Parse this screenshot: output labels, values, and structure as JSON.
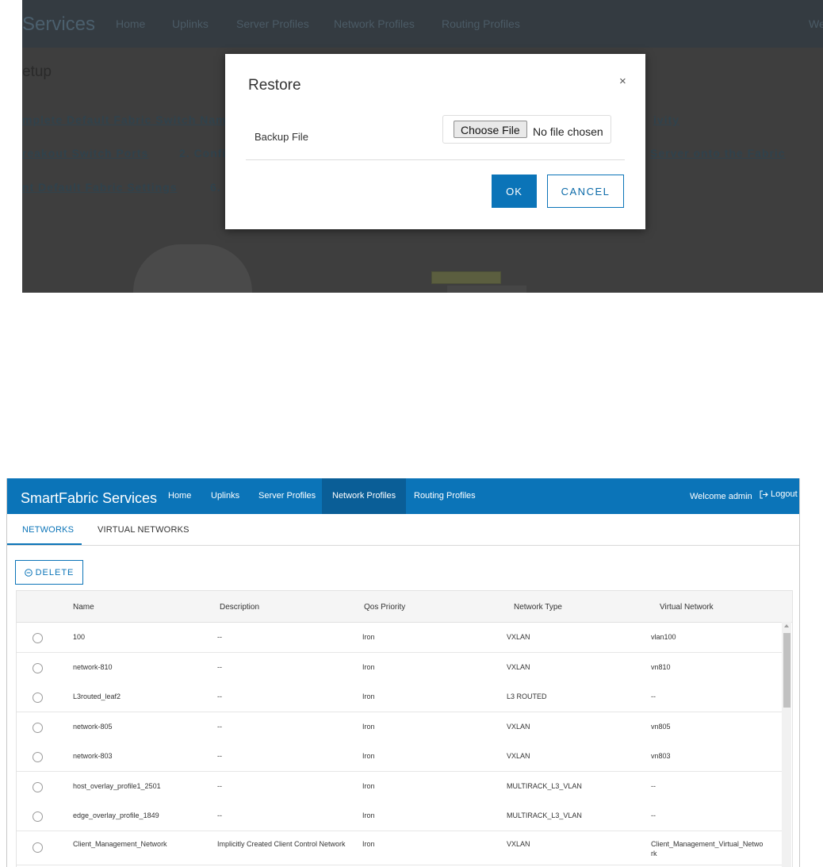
{
  "top_screen": {
    "brand": "Services",
    "nav": [
      "Home",
      "Uplinks",
      "Server Profiles",
      "Network Profiles",
      "Routing Profiles"
    ],
    "welcome": "We",
    "setup_heading": "etup",
    "steps": [
      "mplete Default Fabric Switch Nam",
      "ivity",
      "reakout Switch Ports",
      "2. Confi",
      "Server onto the Fabric",
      "nt Default Fabric Settings",
      "6."
    ],
    "modal": {
      "title": "Restore",
      "close": "×",
      "field_label": "Backup File",
      "choose_file": "Choose File",
      "no_file": "No file chosen",
      "ok": "OK",
      "cancel": "CANCEL"
    }
  },
  "bottom_screen": {
    "brand": "SmartFabric Services",
    "nav": [
      {
        "label": "Home",
        "active": false
      },
      {
        "label": "Uplinks",
        "active": false
      },
      {
        "label": "Server Profiles",
        "active": false
      },
      {
        "label": "Network Profiles",
        "active": true
      },
      {
        "label": "Routing Profiles",
        "active": false
      }
    ],
    "welcome": "Welcome admin",
    "logout": "Logout",
    "tabs": [
      {
        "label": "NETWORKS",
        "active": true
      },
      {
        "label": "VIRTUAL NETWORKS",
        "active": false
      }
    ],
    "delete_label": "DELETE",
    "columns": [
      "Name",
      "Description",
      "Qos Priority",
      "Network Type",
      "Virtual Network"
    ],
    "rows": [
      [
        "100",
        "--",
        "Iron",
        "VXLAN",
        "vlan100"
      ],
      [
        "network-810",
        "--",
        "Iron",
        "VXLAN",
        "vn810"
      ],
      [
        "L3routed_leaf2",
        "--",
        "Iron",
        "L3 ROUTED",
        "--"
      ],
      [
        "network-805",
        "--",
        "Iron",
        "VXLAN",
        "vn805"
      ],
      [
        "network-803",
        "--",
        "Iron",
        "VXLAN",
        "vn803"
      ],
      [
        "host_overlay_profile1_2501",
        "--",
        "Iron",
        "MULTIRACK_L3_VLAN",
        "--"
      ],
      [
        "edge_overlay_profile_1849",
        "--",
        "Iron",
        "MULTIRACK_L3_VLAN",
        "--"
      ],
      [
        "Client_Management_Network",
        "Implicitly Created Client Control Network",
        "Iron",
        "VXLAN",
        "Client_Management_Virtual_Network"
      ]
    ]
  }
}
